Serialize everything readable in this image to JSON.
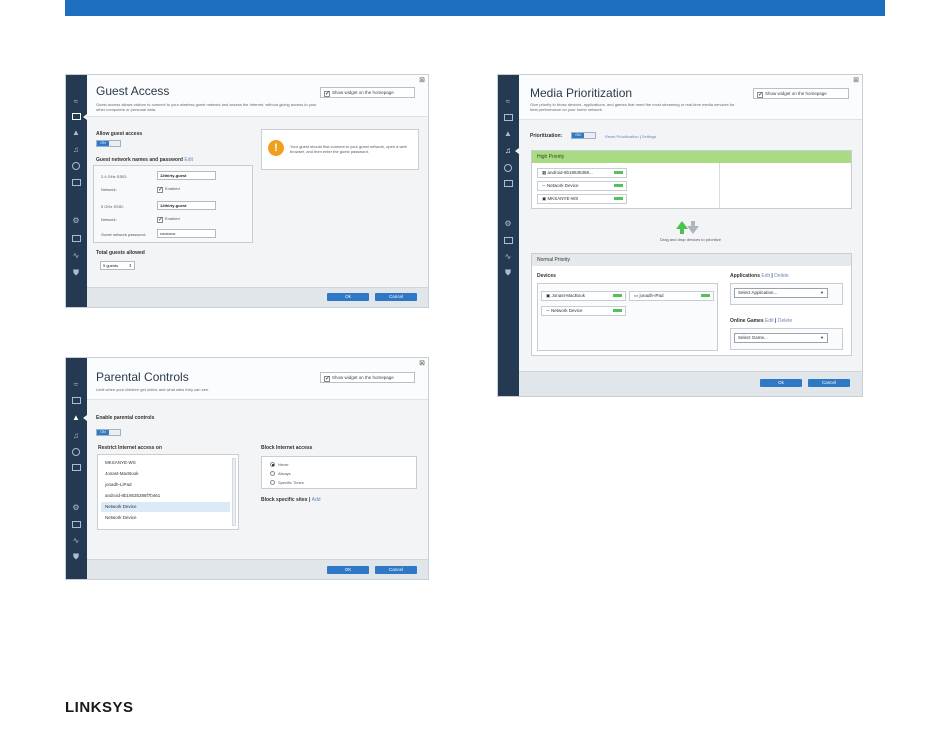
{
  "brand": {
    "logo_text": "LINKSYS",
    "accent": "#1f6fc0"
  },
  "guest": {
    "title": "Guest Access",
    "desc": "Guest access allows visitors to connect to your wireless guest network and access the Internet, without giving access to your other computers or personal data.",
    "show_widget": "Show widget on the homepage",
    "allow_label": "Allow guest access",
    "toggle": "ON",
    "names_label": "Guest network names and password",
    "edit": "Edit",
    "ssid24_label": "2.4 GHz SSID:",
    "ssid24_value": "12thirty-guest",
    "network_label": "Network:",
    "enabled": "Enabled",
    "ssid5_label": "5 GHz SSID:",
    "ssid5_value": "12thirty-guest",
    "password_label": "Guest network password:",
    "password_value": "•••••••••••",
    "info": "Your guest should first connect to your guest network, open a web browser, and then enter the guest password.",
    "total_label": "Total guests allowed",
    "total_value": "5 guests",
    "ok": "Ok",
    "cancel": "Cancel"
  },
  "parental": {
    "title": "Parental Controls",
    "desc": "Limit when your children get online and what sites they can see.",
    "show_widget": "Show widget on the homepage",
    "enable_label": "Enable parental controls",
    "toggle": "ON",
    "restrict_label": "Restrict Internet access on",
    "devices": [
      "MKSANYE-WS",
      "Jonast-MacBook",
      "jonadh-LiPad",
      "android-8b19535388f7b461",
      "Network Device",
      "Network Device"
    ],
    "block_label": "Block Internet access",
    "radios": [
      "Never",
      "Always",
      "Specific Times"
    ],
    "sites_label": "Block specific sites",
    "add": "Add",
    "ok": "OK",
    "cancel": "Cancel"
  },
  "media": {
    "title": "Media Prioritization",
    "desc": "Give priority to those devices, applications, and games that need the most streaming or real-time media services for best performance on your home network.",
    "show_widget": "Show widget on the homepage",
    "prio_label": "Prioritization:",
    "toggle": "ON",
    "reset": "Reset Prioritization",
    "settings": "Settings",
    "high": "High Priority",
    "high_devices": [
      "android-8b19535388...",
      "Network Device",
      "MKSANYE-WS"
    ],
    "drag_hint": "Drag and drop devices to prioritize",
    "normal": "Normal Priority",
    "devices_label": "Devices",
    "normal_devices": [
      "Jonast-MacBook",
      "jonadh-iPad",
      "Network Device"
    ],
    "apps_label": "Applications",
    "edit": "Edit",
    "delete": "Delete",
    "select_app": "Select Application...",
    "games_label": "Online Games",
    "select_game": "Select Game...",
    "ok": "Ok",
    "cancel": "Cancel"
  }
}
